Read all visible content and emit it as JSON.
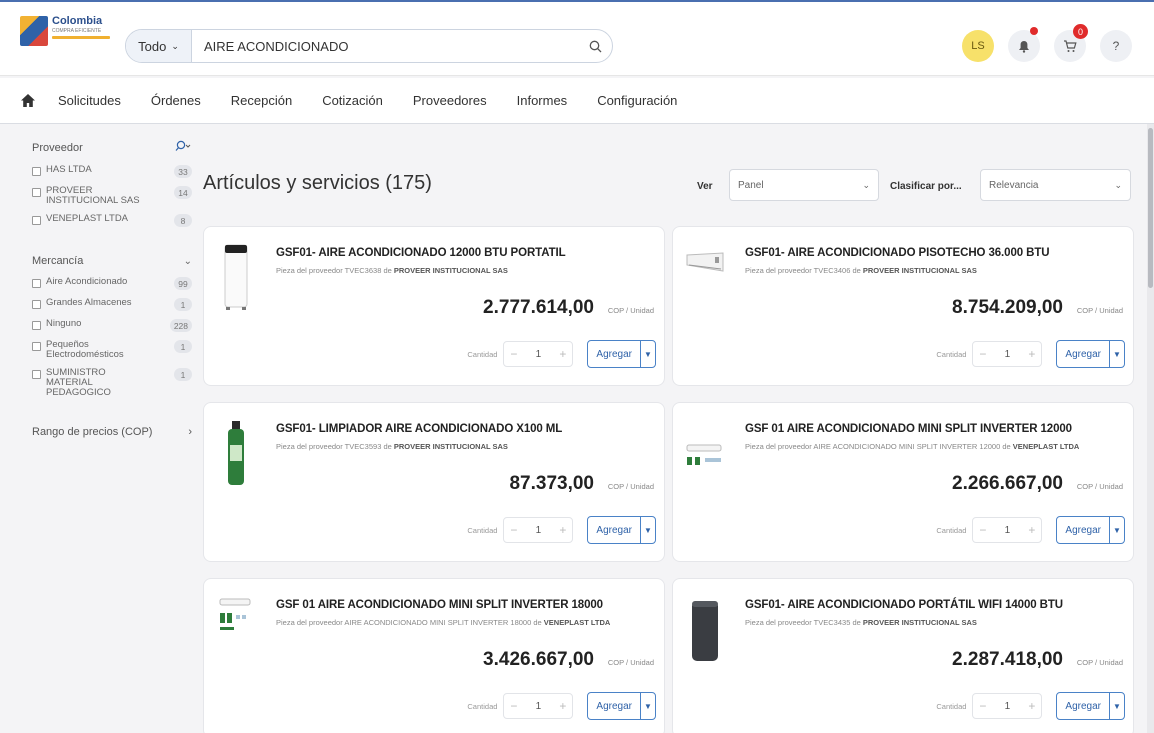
{
  "header": {
    "logo_title": "Colombia",
    "logo_sub": "COMPRA EFICIENTE",
    "search_category": "Todo",
    "search_value": "AIRE ACONDICIONADO",
    "avatar_initials": "LS",
    "cart_count": "0",
    "help_label": "?"
  },
  "nav": {
    "items": [
      "Solicitudes",
      "Órdenes",
      "Recepción",
      "Cotización",
      "Proveedores",
      "Informes",
      "Configuración"
    ]
  },
  "sidebar": {
    "provider_title": "Proveedor",
    "providers": [
      {
        "label": "HAS LTDA",
        "count": "33"
      },
      {
        "label": "PROVEER INSTITUCIONAL SAS",
        "count": "14"
      },
      {
        "label": "VENEPLAST LTDA",
        "count": "8"
      }
    ],
    "merch_title": "Mercancía",
    "merch": [
      {
        "label": "Aire Acondicionado",
        "count": "99"
      },
      {
        "label": "Grandes Almacenes",
        "count": "1"
      },
      {
        "label": "Ninguno",
        "count": "228"
      },
      {
        "label": "Pequeños Electrodomésticos",
        "count": "1"
      },
      {
        "label": "SUMINISTRO MATERIAL PEDAGOGICO",
        "count": "1"
      }
    ],
    "price_range": "Rango de precios (COP)"
  },
  "content": {
    "title": "Artículos y servicios (175)",
    "ver_label": "Ver",
    "ver_value": "Panel",
    "sort_label": "Clasificar por...",
    "sort_value": "Relevancia"
  },
  "common": {
    "unit": "COP / Unidad",
    "qty_label": "Cantidad",
    "qty_value": "1",
    "add_label": "Agregar",
    "supplier_prefix": "Pieza del proveedor",
    "supplier_of": "de"
  },
  "products": [
    {
      "title": "GSF01- AIRE ACONDICIONADO 12000 BTU PORTATIL",
      "part": "TVEC3638",
      "supplier": "PROVEER INSTITUCIONAL SAS",
      "price": "2.777.614,00",
      "icon": "portable-ac-icon"
    },
    {
      "title": "GSF01- AIRE ACONDICIONADO PISOTECHO 36.000 BTU",
      "part": "TVEC3406",
      "supplier": "PROVEER INSTITUCIONAL SAS",
      "price": "8.754.209,00",
      "icon": "ceiling-ac-icon"
    },
    {
      "title": "GSF01- LIMPIADOR AIRE ACONDICIONADO X100 ML",
      "part": "TVEC3593",
      "supplier": "PROVEER INSTITUCIONAL SAS",
      "price": "87.373,00",
      "icon": "cleaner-bottle-icon"
    },
    {
      "title": "GSF 01 AIRE ACONDICIONADO MINI SPLIT INVERTER 12000",
      "part": "AIRE ACONDICIONADO MINI SPLIT INVERTER 12000",
      "supplier": "VENEPLAST LTDA",
      "price": "2.266.667,00",
      "icon": "mini-split-icon"
    },
    {
      "title": "GSF 01 AIRE ACONDICIONADO MINI SPLIT INVERTER 18000",
      "part": "AIRE ACONDICIONADO MINI SPLIT INVERTER 18000",
      "supplier": "VENEPLAST LTDA",
      "price": "3.426.667,00",
      "icon": "mini-split-icon"
    },
    {
      "title": "GSF01- AIRE ACONDICIONADO PORTÁTIL WIFI 14000 BTU",
      "part": "TVEC3435",
      "supplier": "PROVEER INSTITUCIONAL SAS",
      "price": "2.287.418,00",
      "icon": "portable-ac-dark-icon"
    }
  ]
}
